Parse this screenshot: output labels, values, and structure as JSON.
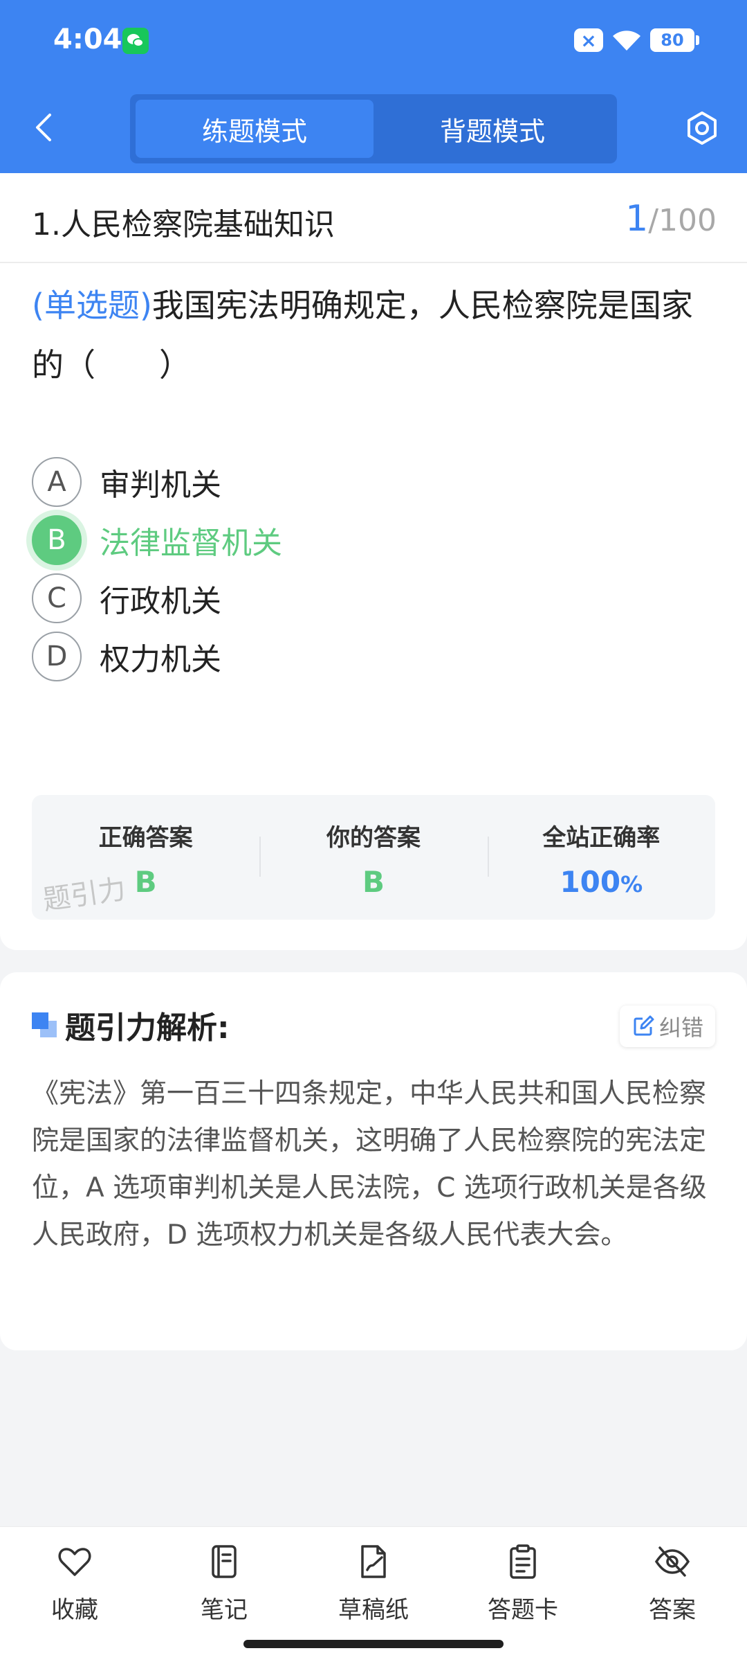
{
  "status": {
    "time": "4:04",
    "battery": "80",
    "notice_badge": "×"
  },
  "header": {
    "modes": [
      {
        "label": "练题模式",
        "active": true
      },
      {
        "label": "背题模式",
        "active": false
      }
    ]
  },
  "question": {
    "title": "1.人民检察院基础知识",
    "current": "1",
    "total": "/100",
    "type": "(单选题)",
    "text": "我国宪法明确规定，人民检察院是国家的（　　）",
    "options": [
      {
        "key": "A",
        "label": "审判机关"
      },
      {
        "key": "B",
        "label": "法律监督机关",
        "selected": true
      },
      {
        "key": "C",
        "label": "行政机关"
      },
      {
        "key": "D",
        "label": "权力机关"
      }
    ]
  },
  "answer_summary": {
    "correct_label": "正确答案",
    "correct_value": "B",
    "yours_label": "你的答案",
    "yours_value": "B",
    "rate_label": "全站正确率",
    "rate_value": "100",
    "rate_unit": "%",
    "watermark": "题引力"
  },
  "analysis": {
    "title": "题引力解析:",
    "fix_label": "纠错",
    "body": "《宪法》第一百三十四条规定，中华人民共和国人民检察院是国家的法律监督机关，这明确了人民检察院的宪法定位，A 选项审判机关是人民法院，C 选项行政机关是各级人民政府，D 选项权力机关是各级人民代表大会。"
  },
  "bottom_bar": {
    "favorite": "收藏",
    "notes": "笔记",
    "scratch": "草稿纸",
    "answer_card": "答题卡",
    "answer": "答案"
  },
  "colors": {
    "primary": "#3d84f2",
    "correct": "#5ecb80"
  }
}
